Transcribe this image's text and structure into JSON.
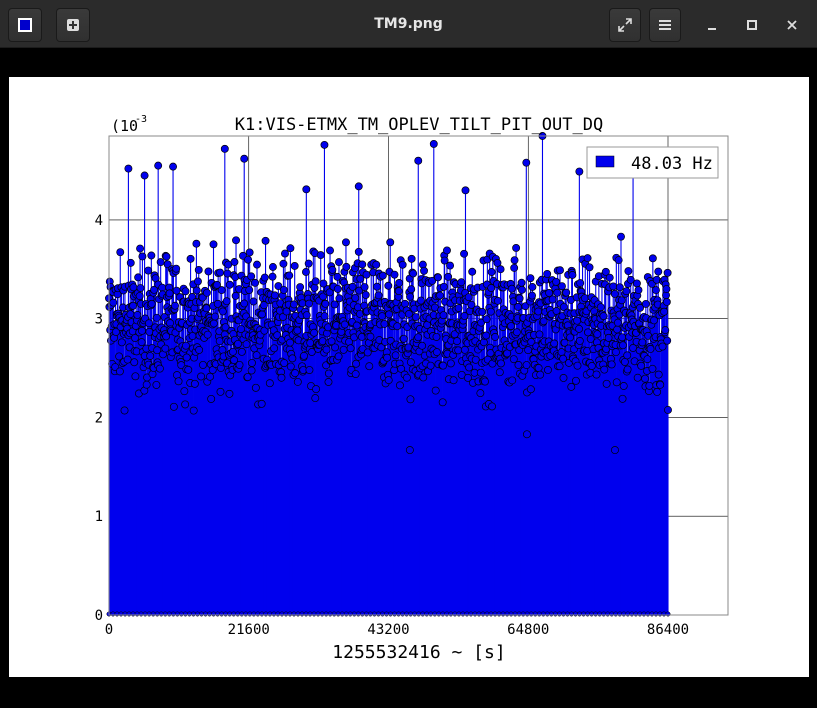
{
  "window": {
    "title": "TM9.png",
    "app_icon": "image-viewer-icon",
    "buttons": {
      "new_tab": "plus-icon",
      "fullscreen": "expand-icon",
      "menu": "hamburger-icon",
      "minimize": "minimize-icon",
      "maximize": "maximize-icon",
      "close": "close-icon"
    }
  },
  "chart_data": {
    "type": "scatter",
    "style": "stem",
    "title": "K1:VIS-ETMX_TM_OPLEV_TILT_PIT_OUT_DQ",
    "xlabel": "1255532416 ~ [s]",
    "ylabel": "",
    "exponent_label": "(10",
    "exponent_value": "-3",
    "xlim": [
      0,
      86400
    ],
    "ylim": [
      0,
      4.85
    ],
    "xticks": [
      0,
      21600,
      43200,
      64800,
      86400
    ],
    "xtick_labels": [
      "0",
      "21600",
      "43200",
      "64800",
      "86400"
    ],
    "yticks": [
      0,
      1,
      2,
      3,
      4
    ],
    "ytick_labels": [
      "0",
      "1",
      "2",
      "3",
      "4"
    ],
    "grid": true,
    "legend_position": "top-right",
    "series": [
      {
        "name": "48.03 Hz",
        "color": "#0000ee",
        "n_points": 1440,
        "x_range": [
          0,
          86400
        ],
        "typical_range": [
          2.0,
          3.9
        ],
        "median": 3.0,
        "peaks": [
          [
            3000,
            4.52
          ],
          [
            5500,
            4.45
          ],
          [
            7600,
            4.55
          ],
          [
            9900,
            4.54
          ],
          [
            17900,
            4.72
          ],
          [
            20900,
            4.62
          ],
          [
            30500,
            4.31
          ],
          [
            33300,
            4.76
          ],
          [
            38600,
            4.34
          ],
          [
            47800,
            4.6
          ],
          [
            50200,
            4.77
          ],
          [
            55100,
            4.3
          ],
          [
            64500,
            4.58
          ],
          [
            67000,
            4.85
          ],
          [
            72700,
            4.49
          ],
          [
            81000,
            4.58
          ]
        ],
        "dips": [
          [
            46500,
            1.67
          ],
          [
            64600,
            1.83
          ],
          [
            78200,
            1.67
          ]
        ]
      }
    ]
  }
}
